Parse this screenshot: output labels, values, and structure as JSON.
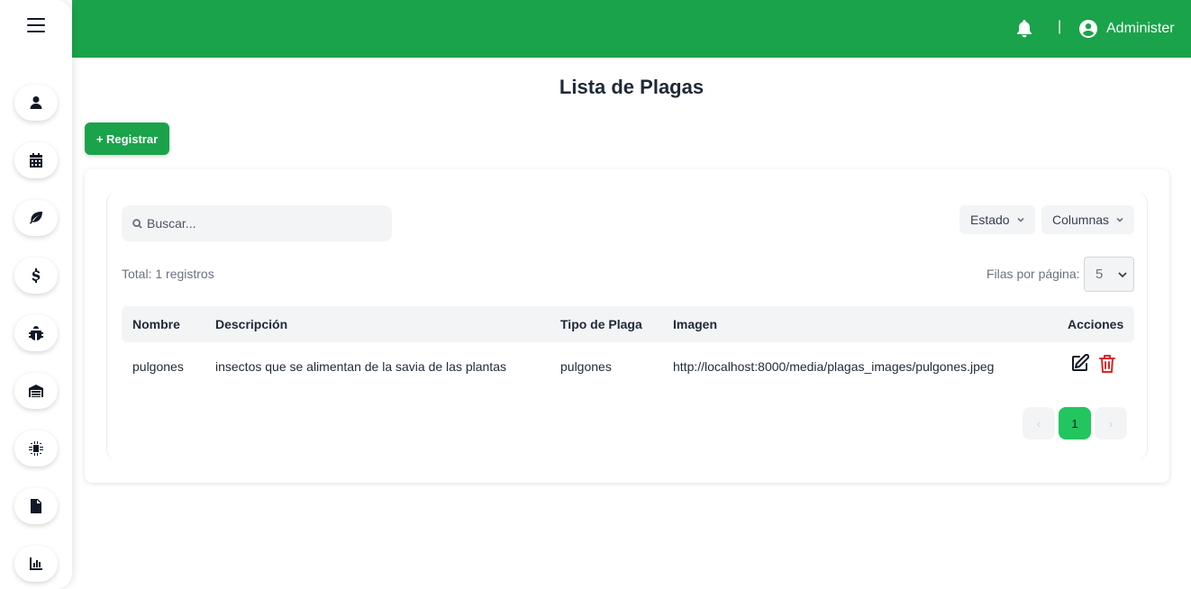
{
  "sidebar": {
    "menu_icon": "hamburger-icon",
    "items": [
      {
        "icon": "user-icon"
      },
      {
        "icon": "calendar-icon"
      },
      {
        "icon": "leaf-icon"
      },
      {
        "icon": "dollar-icon"
      },
      {
        "icon": "bug-icon"
      },
      {
        "icon": "warehouse-icon"
      },
      {
        "icon": "microchip-icon"
      },
      {
        "icon": "document-icon"
      },
      {
        "icon": "bar-chart-icon"
      }
    ]
  },
  "header": {
    "separator": "|",
    "user_name": "Administer",
    "bg_color": "#1aa34a"
  },
  "page": {
    "title": "Lista de Plagas",
    "register_button": "+ Registrar"
  },
  "filters": {
    "search_placeholder": "Buscar...",
    "estado_label": "Estado",
    "columnas_label": "Columnas",
    "total_text": "Total: 1 registros",
    "rows_per_page_label": "Filas por página:",
    "rows_per_page_value": "5"
  },
  "table": {
    "columns": [
      "Nombre",
      "Descripción",
      "Tipo de Plaga",
      "Imagen",
      "Acciones"
    ],
    "rows": [
      {
        "nombre": "pulgones",
        "descripcion": "insectos que se alimentan de la savia de las plantas",
        "tipo": "pulgones",
        "imagen": "http://localhost:8000/media/plagas_images/pulgones.jpeg"
      }
    ]
  },
  "pagination": {
    "prev": "‹",
    "current": "1",
    "next": "›"
  },
  "colors": {
    "primary_green": "#1aa34a",
    "active_page": "#22c55e",
    "delete_red": "#dc2626"
  }
}
